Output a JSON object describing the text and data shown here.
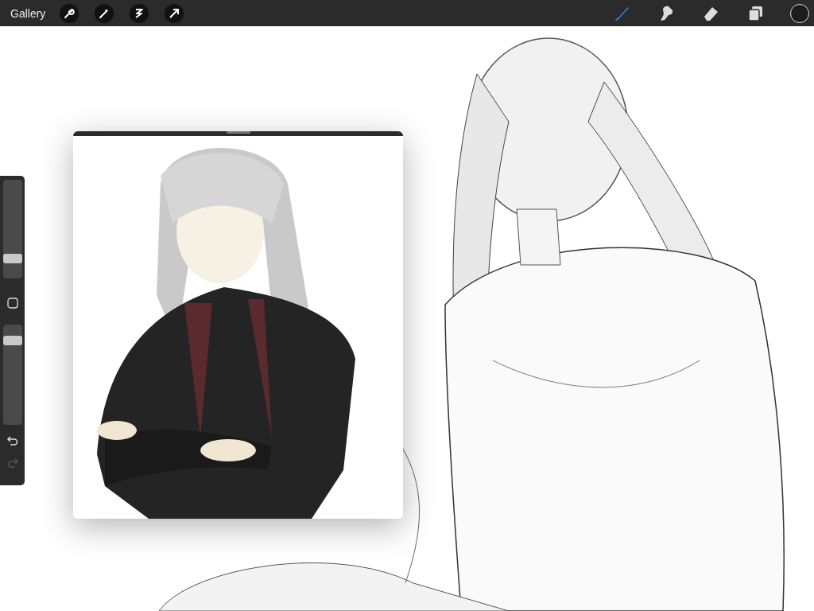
{
  "top_bar": {
    "gallery": "Gallery",
    "left_tools": [
      {
        "kind": "wrench"
      },
      {
        "kind": "wand"
      },
      {
        "kind": "selection"
      },
      {
        "kind": "transform"
      }
    ],
    "right_tools": [
      {
        "kind": "brush",
        "selected": true
      },
      {
        "kind": "smudge",
        "selected": false
      },
      {
        "kind": "eraser",
        "selected": false
      },
      {
        "kind": "layers",
        "selected": false
      }
    ],
    "color": "#1c1c1c"
  },
  "sidebar": {
    "sliders": [
      {
        "level": 0.2
      },
      {
        "level": 0.84
      }
    ],
    "redo_disabled": true
  }
}
